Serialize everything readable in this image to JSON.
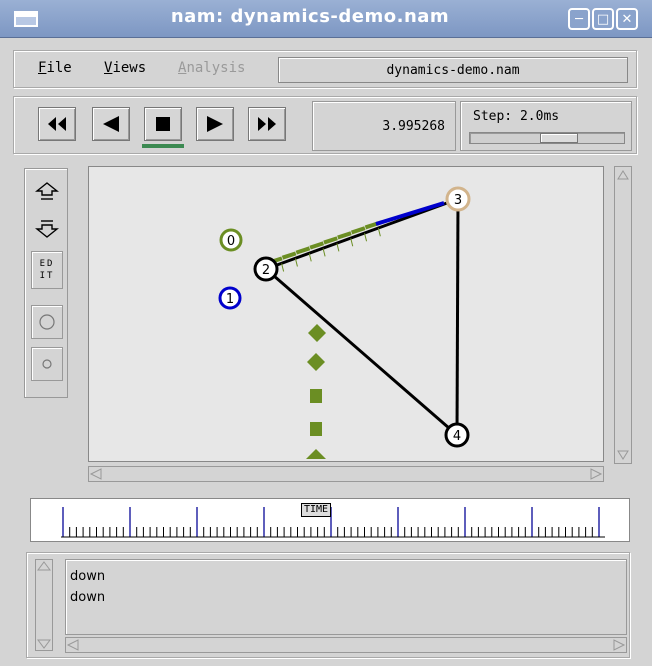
{
  "window": {
    "title": "nam: dynamics-demo.nam"
  },
  "menu": {
    "file": {
      "mnemonic": "F",
      "rest": "ile"
    },
    "views": {
      "mnemonic": "V",
      "rest": "iews"
    },
    "analysis": {
      "mnemonic": "A",
      "rest": "nalysis",
      "enabled": false
    },
    "filename": "dynamics-demo.nam"
  },
  "playback": {
    "buttons": [
      "rewind-icon",
      "play-backward-icon",
      "stop-icon",
      "play-icon",
      "fast-forward-icon"
    ],
    "active": "stop",
    "time": "3.995268",
    "step_label": "Step: 2.0ms"
  },
  "tools": {
    "edit_label_top": "ED",
    "edit_label_bottom": "IT"
  },
  "network": {
    "nodes": [
      {
        "id": "0",
        "label": "0",
        "color": "#6b8e23"
      },
      {
        "id": "1",
        "label": "1",
        "color": "#0000cc"
      },
      {
        "id": "2",
        "label": "2",
        "color": "#000000"
      },
      {
        "id": "3",
        "label": "3",
        "color": "#d2b48c"
      },
      {
        "id": "4",
        "label": "4",
        "color": "#000000"
      }
    ],
    "links": [
      [
        "2",
        "3"
      ],
      [
        "3",
        "4"
      ],
      [
        "2",
        "4"
      ]
    ],
    "packet_colors": {
      "green": "#6b8e23",
      "blue": "#0000cc"
    }
  },
  "timeline": {
    "label": "TIME"
  },
  "log": {
    "lines": [
      "down",
      "down"
    ]
  }
}
